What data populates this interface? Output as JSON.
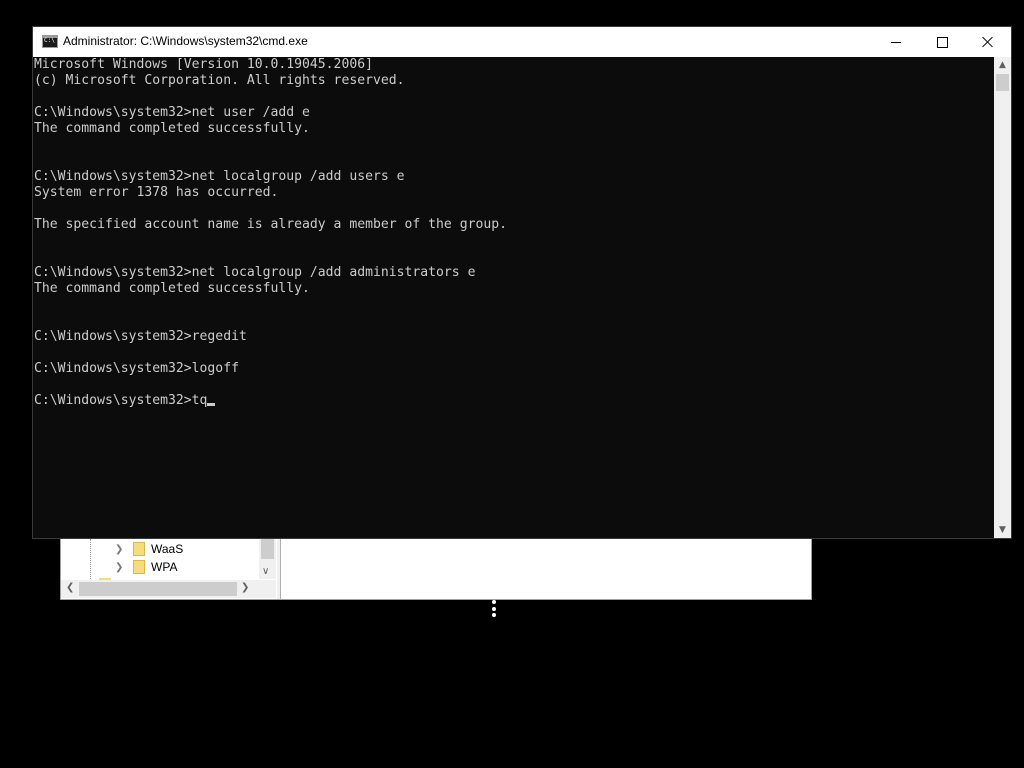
{
  "regedit": {
    "tree_items": [
      {
        "label": "WaaS",
        "icon": "folder-icon"
      },
      {
        "label": "WPA",
        "icon": "folder-icon"
      }
    ]
  },
  "cmd": {
    "title": "Administrator: C:\\Windows\\system32\\cmd.exe",
    "lines": [
      "Microsoft Windows [Version 10.0.19045.2006]",
      "(c) Microsoft Corporation. All rights reserved.",
      "",
      "C:\\Windows\\system32>net user /add e",
      "The command completed successfully.",
      "",
      "",
      "C:\\Windows\\system32>net localgroup /add users e",
      "System error 1378 has occurred.",
      "",
      "The specified account name is already a member of the group.",
      "",
      "",
      "C:\\Windows\\system32>net localgroup /add administrators e",
      "The command completed successfully.",
      "",
      "",
      "C:\\Windows\\system32>regedit",
      "",
      "C:\\Windows\\system32>logoff",
      "",
      "C:\\Windows\\system32>tq"
    ],
    "colors": {
      "console_bg": "#0c0c0c",
      "console_fg": "#cccccc",
      "titlebar_bg": "#ffffff"
    }
  },
  "icons": {
    "app": "cmd-app-icon",
    "minimize": "minimize-icon",
    "maximize": "maximize-icon",
    "close": "close-icon",
    "loading": "loading-dots-icon"
  }
}
